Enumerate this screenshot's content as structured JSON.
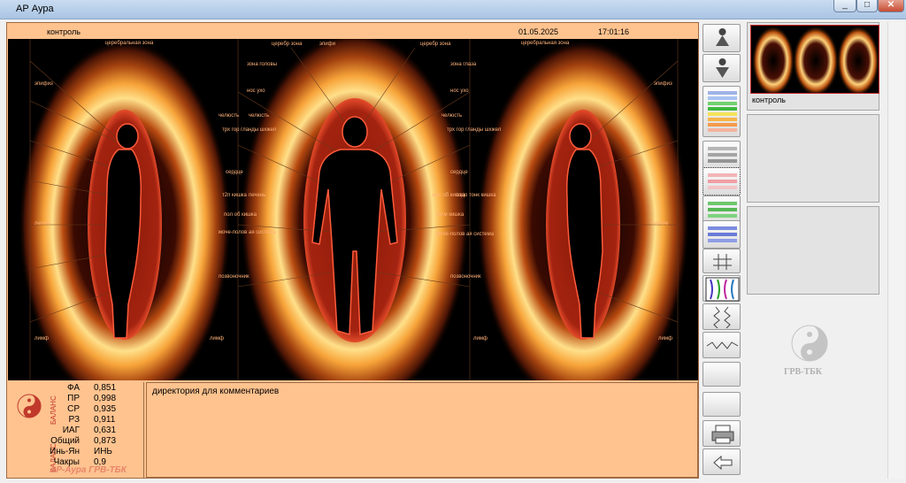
{
  "window": {
    "title": "АР Аура"
  },
  "header": {
    "mode": "контроль",
    "date": "01.05.2025",
    "time": "17:01:16"
  },
  "zones": {
    "cerebral": "церебральная зона",
    "cerebral_short": "церебр зона",
    "epiphysis": "эпифиз",
    "epiphysis_short": "эпифи",
    "eye": "зона глаза",
    "head": "зона головы",
    "nose": "нос ухо",
    "jaw": "челюсть",
    "throat": "трх гор гланды шхжел",
    "heart": "сердце",
    "t2n": "т2п кишка",
    "liver": "печень",
    "thick": "нис об кишка",
    "thin": "подо тонк кишка",
    "colon": "сигм кишка",
    "poloslab": "пол об кишка",
    "urinary": "моче-полов ая система",
    "spine": "позвоночник",
    "legs": "лимф",
    "lung": "легкие"
  },
  "stats": {
    "group1_label": "БАЛАНС",
    "group2_label": "БАЛАНС",
    "rows": [
      {
        "k": "ФА",
        "v": "0,851"
      },
      {
        "k": "ПР",
        "v": "0,998"
      },
      {
        "k": "СР",
        "v": "0,935"
      },
      {
        "k": "РЗ",
        "v": "0,911"
      },
      {
        "k": "ИАГ",
        "v": "0,631"
      },
      {
        "k": "Общий",
        "v": "0,873"
      },
      {
        "k": "Инь-Ян",
        "v": "ИНЬ"
      },
      {
        "k": "Чакры",
        "v": "0,9"
      }
    ],
    "brand": "АР-Аура ГРВ-ТБК"
  },
  "comment": {
    "text": "директория для комментариев"
  },
  "sidebar": {
    "thumb_caption": "контроль",
    "brand": "ГРВ-ТБК"
  },
  "colors": {
    "accent": "#ffc38f",
    "aura_outer": "#5a1a05",
    "aura_inner": "#ffe08a"
  }
}
